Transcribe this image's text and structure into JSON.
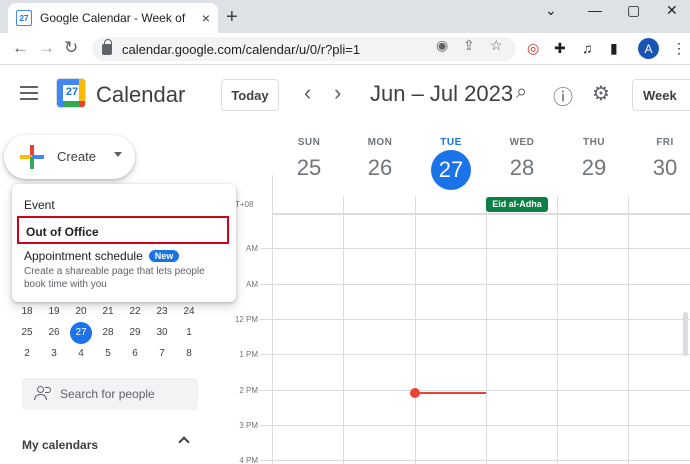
{
  "browser": {
    "tab_title": "Google Calendar - Week of June",
    "tab_favicon_text": "27",
    "tab_close": "×",
    "new_tab": "+",
    "url": "calendar.google.com/calendar/u/0/r?pli=1",
    "profile_initial": "A",
    "window_controls": {
      "minimize": "—",
      "maximize": "▢",
      "close": "✕",
      "dropdown": "⌄"
    }
  },
  "header": {
    "app_name": "Calendar",
    "logo_number": "27",
    "today_label": "Today",
    "date_range": "Jun – Jul 2023",
    "view_label": "Week"
  },
  "create": {
    "label": "Create",
    "menu": {
      "event": "Event",
      "out_of_office": "Out of Office",
      "appointment": "Appointment schedule",
      "new_badge": "New",
      "appointment_desc": "Create a shareable page that lets people book time with you"
    }
  },
  "mini_calendar": {
    "rows": [
      [
        "18",
        "19",
        "20",
        "21",
        "22",
        "23",
        "24"
      ],
      [
        "25",
        "26",
        "27",
        "28",
        "29",
        "30",
        "1"
      ],
      [
        "2",
        "3",
        "4",
        "5",
        "6",
        "7",
        "8"
      ]
    ],
    "today": "27"
  },
  "sidebar": {
    "search_placeholder": "Search for people",
    "my_calendars": "My calendars"
  },
  "week": {
    "timezone": "T+08",
    "days": [
      {
        "name": "SUN",
        "num": "25"
      },
      {
        "name": "MON",
        "num": "26"
      },
      {
        "name": "TUE",
        "num": "27"
      },
      {
        "name": "WED",
        "num": "28"
      },
      {
        "name": "THU",
        "num": "29"
      },
      {
        "name": "FRI",
        "num": "30"
      }
    ],
    "time_labels": [
      "AM",
      "AM",
      "12 PM",
      "1 PM",
      "2 PM",
      "3 PM",
      "4 PM"
    ],
    "event_chip": "Eid al-Adha"
  },
  "colors": {
    "accent": "#1a73e8",
    "highlight_box": "#d0021b",
    "event_green": "#0b8043",
    "now_line": "#ea4335"
  }
}
